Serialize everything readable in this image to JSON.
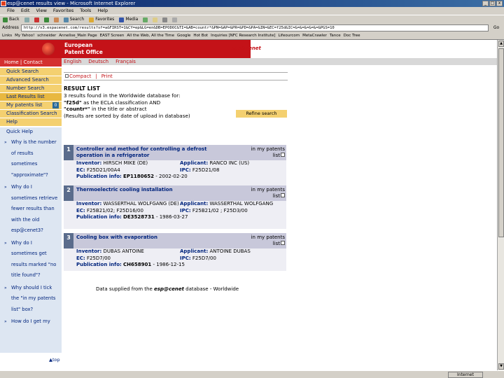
{
  "window": {
    "title": "esp@cenet results view - Microsoft Internet Explorer",
    "buttons": [
      "_",
      "□",
      "x"
    ]
  },
  "menu": [
    "File",
    "Edit",
    "View",
    "Favorites",
    "Tools",
    "Help"
  ],
  "toolbar": [
    "Back",
    "Forward",
    "Stop",
    "Refresh",
    "Home",
    "Search",
    "Favorites",
    "Media",
    "History",
    "Mail",
    "Print",
    "Edit",
    "Discuss"
  ],
  "address": {
    "label": "Address",
    "url": "http://v3.espacenet.com/results?sf=a&FIRST=1&CY=ep&LG=en&DB=EPODOC&TI=&AB=countr*&PN=&AP=&PR=&PD=&PA=&IN=&EC=f25d&IC=&=&=&=&=&=&PGS=10",
    "go": "Go"
  },
  "links": [
    "Links",
    "My Yahoo!",
    "schneider",
    "Annelise_Main Page",
    "EAST Screen",
    "All the Web, All the Time",
    "Google",
    "Hot Bot",
    "Inquiries [NFC Research Institute]",
    "Lifeourcom",
    "MetaCrawler",
    "Tance",
    "Doc Tree"
  ],
  "header": {
    "org": "European Patent Office",
    "langs": [
      "English",
      "Deutsch",
      "Français"
    ],
    "home": "Home | Contact",
    "brand": "esp@cenet"
  },
  "sidebar": {
    "nav": [
      "Quick Search",
      "Advanced Search",
      "Number Search",
      "Last Results list"
    ],
    "my_patents": "My patents list",
    "my_patents_count": "0",
    "nav2": [
      "Classification Search",
      "Help"
    ],
    "quick_help": "Quick Help",
    "help_items": [
      "Why is the number of results sometimes \"approximate\"?",
      "Why do I sometimes retrieve fewer results than with the old esp@cenet3?",
      "Why do I sometimes get results marked \"no title found\"?",
      "Why should I tick the \"in my patents list\" box?",
      "How do I get my"
    ],
    "top": "top"
  },
  "main": {
    "compact": "Compact",
    "print": "Print",
    "heading": "RESULT LIST",
    "summary_line1": "3 results found in the Worldwide database for:",
    "q1": "\"f25d\"",
    "q1_text": "as the ECLA classification AND",
    "q2": "\"countr*\"",
    "q2_text": "in the title or abstract",
    "sorted": "(Results are sorted by date of upload in database)",
    "refine": "Refine search",
    "in_list": "in my patents list",
    "labels": {
      "inventor": "Inventor:",
      "applicant": "Applicant:",
      "ec": "EC:",
      "ipc": "IPC:",
      "pub": "Publication info:"
    },
    "results": [
      {
        "num": "1",
        "title": "Controller and method for controlling a defrost operation in a refrigerator",
        "inventor": "HIRSCH MIKE (DE)",
        "applicant": "RANCO INC (US)",
        "ec": "F25D21/00A4",
        "ipc": "F25D21/08",
        "pub_no": "EP1180652",
        "pub_date": "- 2002-02-20"
      },
      {
        "num": "2",
        "title": "Thermoelectric cooling installation",
        "inventor": "WASSERTHAL WOLFGANG (DE)",
        "applicant": "WASSERTHAL WOLFGANG",
        "ec": "F25B21/02; F25D16/00",
        "ipc": "F25B21/02 ; F25D3/00",
        "pub_no": "DE3528731",
        "pub_date": "- 1986-03-27"
      },
      {
        "num": "3",
        "title": "Cooling box with evaporation",
        "inventor": "DUBAS ANTOINE",
        "applicant": "ANTOINE DUBAS",
        "ec": "F25D7/00",
        "ipc": "F25D7/00",
        "pub_no": "CH658901",
        "pub_date": "- 1986-12-15"
      }
    ],
    "footer_pre": "Data supplied from the",
    "footer_brand": "esp@cenet",
    "footer_post": "database - Worldwide"
  },
  "status": {
    "text": "",
    "zone": "Internet"
  }
}
